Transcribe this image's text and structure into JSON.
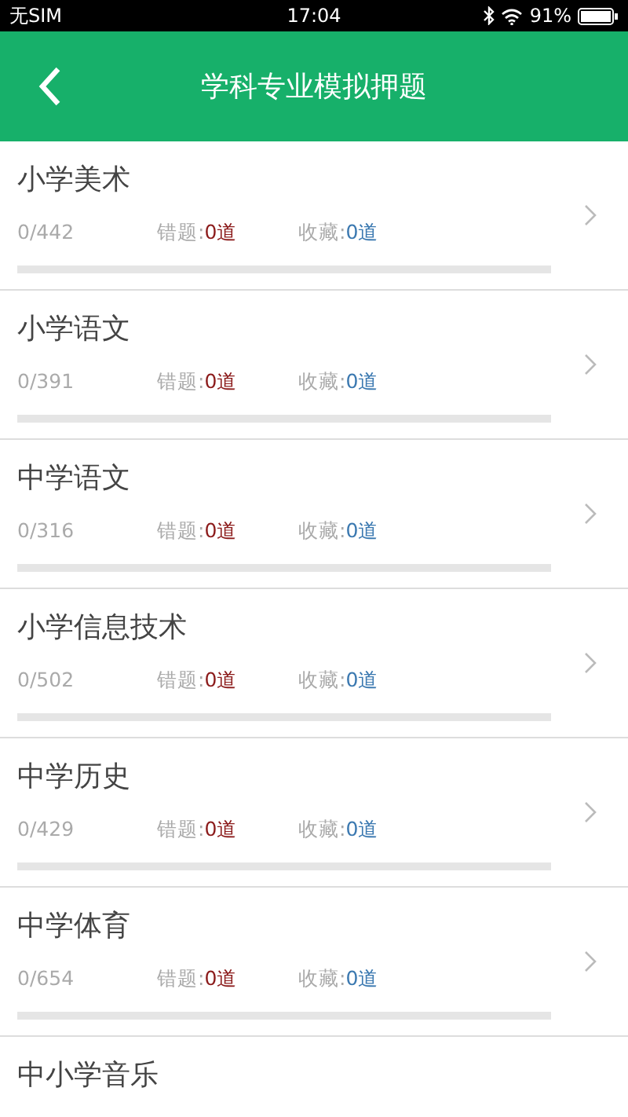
{
  "status_bar": {
    "carrier": "无SIM",
    "time": "17:04",
    "battery": "91%"
  },
  "nav": {
    "title": "学科专业模拟押题"
  },
  "subjects": [
    {
      "name": "小学美术",
      "progress": "0/442",
      "wrong_label": "错题:",
      "wrong": "0道",
      "fav_label": "收藏:",
      "fav": "0道",
      "level": 0
    },
    {
      "name": "小学语文",
      "progress": "0/391",
      "wrong_label": "错题:",
      "wrong": "0道",
      "fav_label": "收藏:",
      "fav": "0道",
      "level": 0
    },
    {
      "name": "中学语文",
      "progress": "0/316",
      "wrong_label": "错题:",
      "wrong": "0道",
      "fav_label": "收藏:",
      "fav": "0道",
      "level": 0
    },
    {
      "name": "小学信息技术",
      "progress": "0/502",
      "wrong_label": "错题:",
      "wrong": "0道",
      "fav_label": "收藏:",
      "fav": "0道",
      "level": 0
    },
    {
      "name": "中学历史",
      "progress": "0/429",
      "wrong_label": "错题:",
      "wrong": "0道",
      "fav_label": "收藏:",
      "fav": "0道",
      "level": 0
    },
    {
      "name": "中学体育",
      "progress": "0/654",
      "wrong_label": "错题:",
      "wrong": "0道",
      "fav_label": "收藏:",
      "fav": "0道",
      "level": 0
    },
    {
      "name": "中小学音乐"
    }
  ]
}
